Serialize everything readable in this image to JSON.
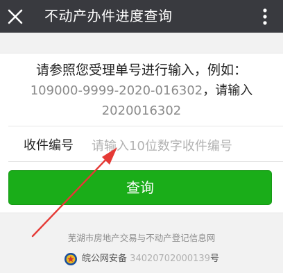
{
  "header": {
    "title": "不动产办件进度查询",
    "close_icon": "close-icon",
    "more_icon": "more-vertical-icon"
  },
  "instructions": {
    "line1": "请参照您受理单号进行输入，例如：",
    "example_number": "109000-9999-2020-016302",
    "line2_suffix": "，请输入",
    "line3": "2020016302"
  },
  "form": {
    "field_label": "收件编号",
    "field_value": "",
    "field_placeholder": "请输入10位数字收件编号",
    "submit_label": "查询"
  },
  "footer": {
    "site_name": "芜湖市房地产交易与不动产登记信息网",
    "police_badge_icon": "police-badge-icon",
    "icp_prefix": "皖公网安备",
    "icp_number": "34020702000139",
    "icp_suffix": "号"
  },
  "colors": {
    "topbar": "#393a3f",
    "primary_button": "#1aad19",
    "annotation_arrow": "#e53935"
  }
}
